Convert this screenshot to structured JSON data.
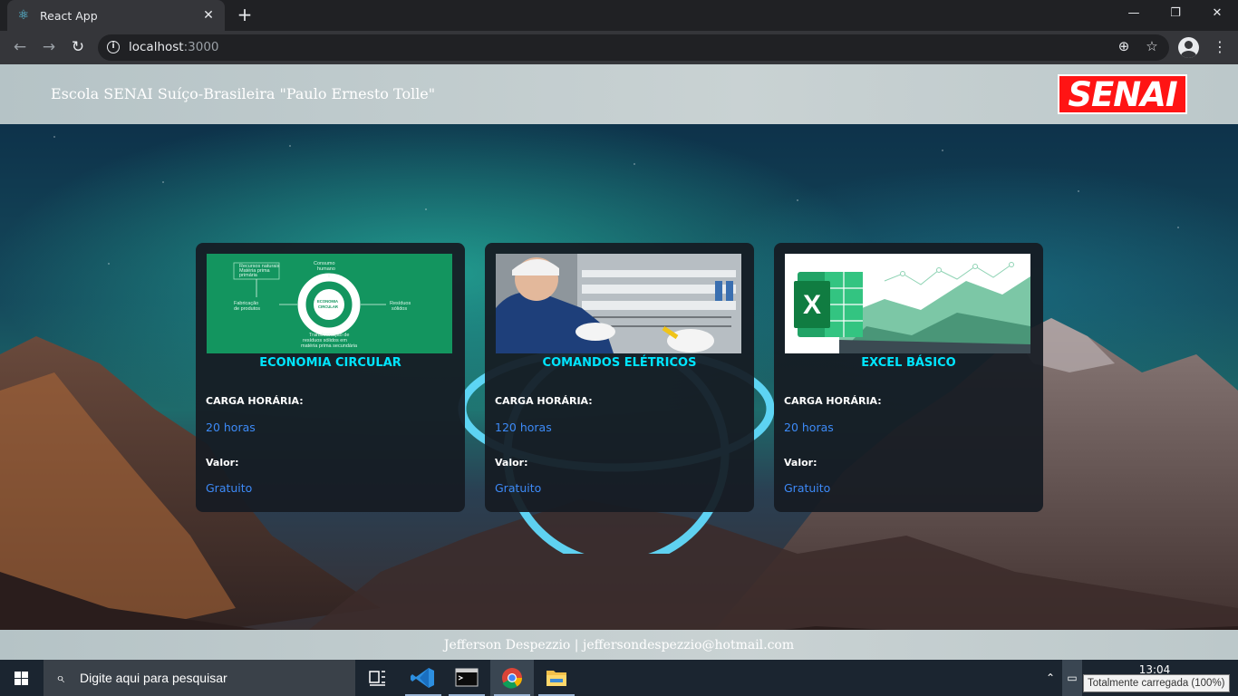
{
  "browser": {
    "tab_title": "React App",
    "url_host": "localhost",
    "url_port": ":3000"
  },
  "header": {
    "title": "Escola SENAI Suíço-Brasileira \"Paulo Ernesto Tolle\"",
    "logo_text": "SENAI"
  },
  "courses": [
    {
      "title": "ECONOMIA CIRCULAR",
      "hours_label": "CARGA HORÁRIA:",
      "hours": "20 horas",
      "price_label": "Valor:",
      "price": "Gratuito",
      "image": {
        "labels": [
          "Recursos naturais",
          "Matéria prima",
          "primária",
          "Consumo",
          "humano",
          "ECONOMIA",
          "CIRCULAR",
          "Fabricação",
          "de produtos",
          "Resíduos",
          "sólidos",
          "Transformação de",
          "resíduos sólidos em",
          "matéria prima secundária"
        ]
      }
    },
    {
      "title": "COMANDOS ELÉTRICOS",
      "hours_label": "CARGA HORÁRIA:",
      "hours": "120 horas",
      "price_label": "Valor:",
      "price": "Gratuito"
    },
    {
      "title": "EXCEL BÁSICO",
      "hours_label": "CARGA HORÁRIA:",
      "hours": "20 horas",
      "price_label": "Valor:",
      "price": "Gratuito"
    }
  ],
  "footer": {
    "text": "Jefferson Despezzio | jeffersondespezzio@hotmail.com"
  },
  "taskbar": {
    "search_placeholder": "Digite aqui para pesquisar",
    "clock": "13:04",
    "battery_tooltip": "Totalmente carregada (100%)"
  },
  "colors": {
    "card_title": "#00e5ff",
    "card_value": "#3d8af7",
    "logo_red": "#ff1414",
    "react_blue": "#61dafb"
  }
}
